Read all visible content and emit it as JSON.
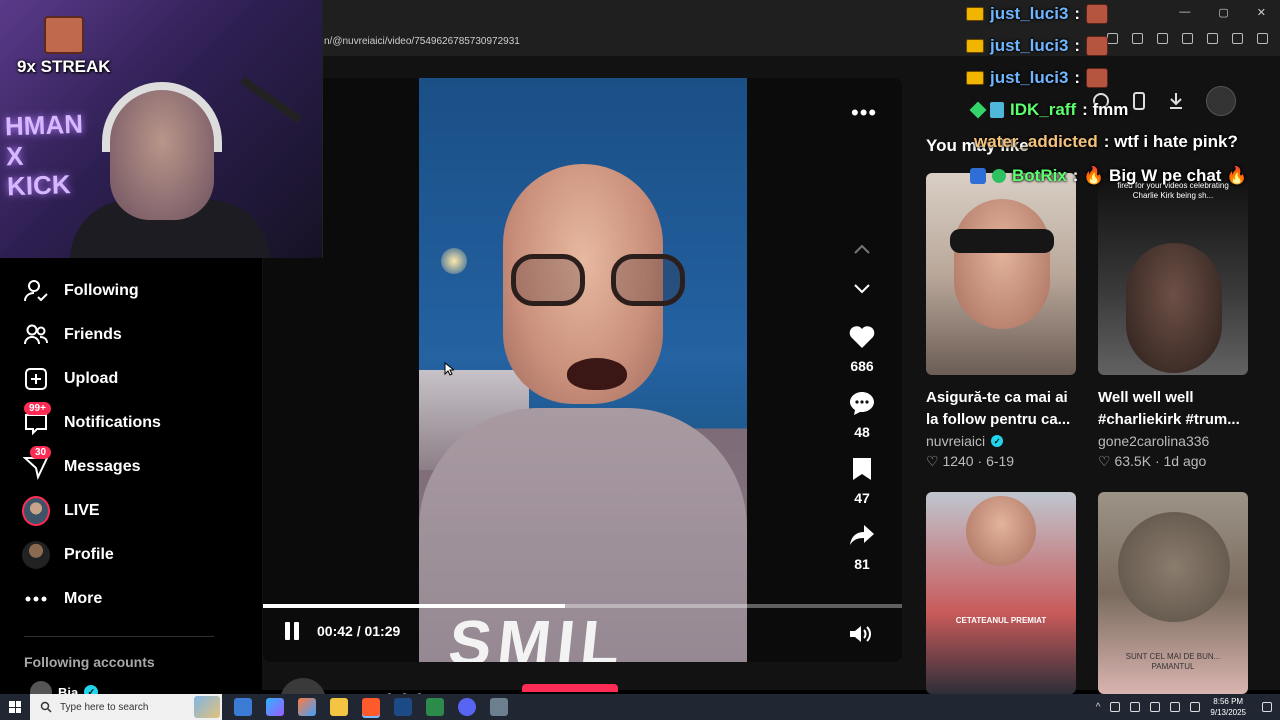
{
  "browser": {
    "url": "n/@nuvreiaici/video/7549626785730972931",
    "window_controls": [
      "—",
      "▢",
      "✕"
    ]
  },
  "webcam": {
    "streak_label": "9x STREAK",
    "neon_sign": "HMAN\nX\nKICK"
  },
  "sidebar": {
    "items": [
      {
        "label": "Following",
        "icon": "following-icon"
      },
      {
        "label": "Friends",
        "icon": "friends-icon"
      },
      {
        "label": "Upload",
        "icon": "upload-icon"
      },
      {
        "label": "Notifications",
        "icon": "notifications-icon",
        "badge": "99+"
      },
      {
        "label": "Messages",
        "icon": "messages-icon",
        "badge": "30"
      },
      {
        "label": "LIVE",
        "icon": "live-avatar"
      },
      {
        "label": "Profile",
        "icon": "profile-avatar"
      },
      {
        "label": "More",
        "icon": "more-icon"
      }
    ],
    "following_accounts_title": "Following accounts",
    "following_first": "Bia"
  },
  "video": {
    "likes": "686",
    "comments": "48",
    "saves": "47",
    "shares": "81",
    "current_time": "00:42",
    "duration": "01:29",
    "time_display": "00:42 / 01:29",
    "progress": 0.472,
    "hoodie_text": "SMIL",
    "author": "nuvreiaici"
  },
  "recommendations": {
    "title": "You may like",
    "cards": [
      {
        "title_line1": "Asigură-te ca mai ai",
        "title_line2": "la follow pentru ca...",
        "author": "nuvreiaici",
        "verified": true,
        "likes": "1240",
        "date": "6-19",
        "thumb_caption": ""
      },
      {
        "title_line1": "Well well well",
        "title_line2": "#charliekirk #trum...",
        "author": "gone2carolina336",
        "verified": false,
        "likes": "63.5K",
        "date": "1d ago",
        "thumb_caption": "fired for your videos celebrating Charlie Kirk being sh..."
      },
      {
        "title_line1": "",
        "title_line2": "",
        "author": "",
        "likes": "",
        "date": "",
        "thumb_caption": "CETATEANUL PREMIAT"
      },
      {
        "title_line1": "",
        "title_line2": "",
        "author": "",
        "likes": "",
        "date": "",
        "thumb_caption": "SUNT CEL MAI DE BUN... PAMANTUL"
      }
    ]
  },
  "chat": {
    "messages": [
      {
        "user": "just_luci3",
        "color": "#6fb6ff",
        "text": ":",
        "badge": "crown",
        "emote": true
      },
      {
        "user": "just_luci3",
        "color": "#6fb6ff",
        "text": ":",
        "badge": "crown",
        "emote": true
      },
      {
        "user": "just_luci3",
        "color": "#6fb6ff",
        "text": ":",
        "badge": "crown",
        "emote": true
      },
      {
        "user": "IDK_raff",
        "color": "#5cff6e",
        "text": ": fmm",
        "badge": "diamond"
      },
      {
        "user": "water_addicted",
        "color": "#f4c27a",
        "text": ": wtf i hate pink?",
        "badge": ""
      },
      {
        "user": "BotRix",
        "color": "#5cff6e",
        "text": ": 🔥 Big W pe chat 🔥",
        "badge": "bot"
      }
    ]
  },
  "taskbar": {
    "search_placeholder": "Type here to search",
    "time": "8:56 PM",
    "date": "9/13/2025"
  },
  "colors": {
    "accent": "#fe2c55",
    "verified": "#20d5ec",
    "chat_blue": "#6fb6ff",
    "chat_green": "#5cff6e"
  }
}
